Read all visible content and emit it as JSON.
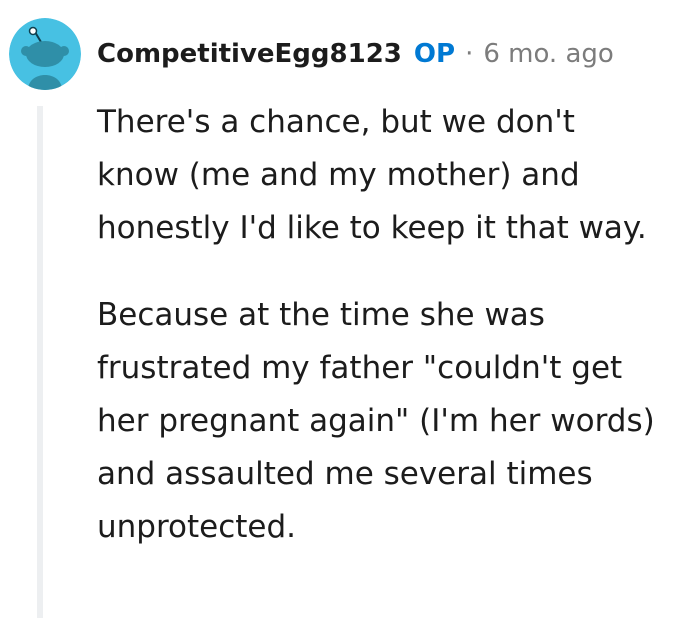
{
  "comment": {
    "author": "CompetitiveEgg8123",
    "op_badge": "OP",
    "separator": "·",
    "timestamp": "6 mo. ago",
    "avatar_icon": "snoo-avatar-icon",
    "colors": {
      "avatar_bg": "#47c1e3",
      "op": "#0079d3",
      "muted": "#7c7c7c",
      "thread_line": "#edeff1"
    },
    "paragraphs": [
      "There's a chance, but we don't know (me and my mother) and honestly I'd like to keep it that way.",
      "Because at the time she was frustrated my father \"couldn't get her pregnant again\" (I'm her words) and assaulted me several times unprotected."
    ]
  }
}
